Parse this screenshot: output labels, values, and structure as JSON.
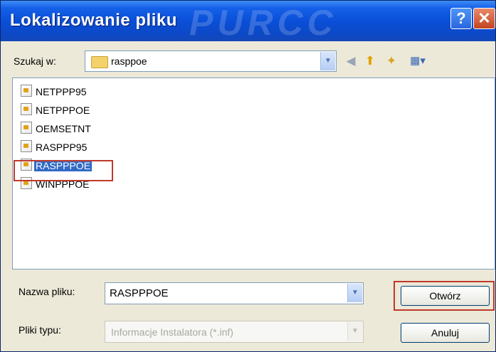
{
  "window": {
    "title": "Lokalizowanie pliku",
    "watermark": "PURCC",
    "help_glyph": "?",
    "close_glyph": "✕"
  },
  "lookin": {
    "label": "Szukaj w:",
    "value": "rasppoe",
    "icon": "folder-icon",
    "dropdown_glyph": "▼"
  },
  "toolbar": {
    "back_glyph": "◀",
    "up_glyph": "⬆",
    "newfolder_glyph": "✦",
    "view_glyph": "▦▾"
  },
  "files": [
    {
      "name": "NETPPP95",
      "selected": false
    },
    {
      "name": "NETPPPOE",
      "selected": false
    },
    {
      "name": "OEMSETNT",
      "selected": false
    },
    {
      "name": "RASPPP95",
      "selected": false
    },
    {
      "name": "RASPPPOE",
      "selected": true
    },
    {
      "name": "WINPPPOE",
      "selected": false
    }
  ],
  "filename": {
    "label": "Nazwa pliku:",
    "value": "RASPPPOE",
    "dropdown_glyph": "▼"
  },
  "filetype": {
    "label": "Pliki typu:",
    "value": "Informacje Instalatora (*.inf)",
    "dropdown_glyph": "▼"
  },
  "buttons": {
    "open": "Otwórz",
    "cancel": "Anuluj"
  },
  "colors": {
    "titlebar": "#0a4fd8",
    "selection": "#316ac5",
    "highlight_box": "#c0392b",
    "dialog_bg": "#ece9d8"
  }
}
